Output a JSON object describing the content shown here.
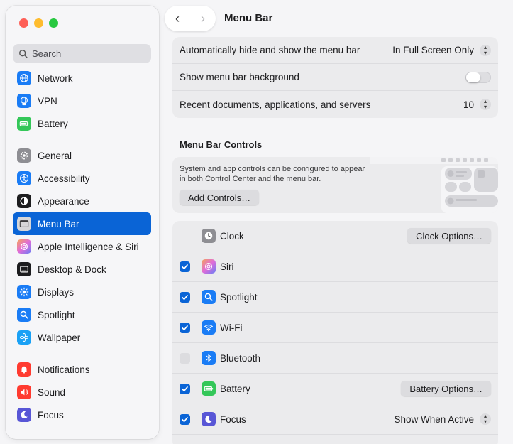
{
  "sidebar": {
    "search_placeholder": "Search",
    "items": [
      {
        "label": "Network",
        "icon": "globe-icon",
        "color": "#1a7cf5"
      },
      {
        "label": "VPN",
        "icon": "vpn-globe-icon",
        "color": "#1a7cf5"
      },
      {
        "label": "Battery",
        "icon": "battery-icon",
        "color": "#34c759"
      },
      {
        "label": "General",
        "icon": "gear-icon",
        "color": "#8e8e93"
      },
      {
        "label": "Accessibility",
        "icon": "accessibility-icon",
        "color": "#1a7cf5"
      },
      {
        "label": "Appearance",
        "icon": "appearance-icon",
        "color": "#1d1d1f"
      },
      {
        "label": "Menu Bar",
        "icon": "menu-bar-icon",
        "color": "#ffffff"
      },
      {
        "label": "Apple Intelligence & Siri",
        "icon": "siri-icon",
        "color": "#e06cd8"
      },
      {
        "label": "Desktop & Dock",
        "icon": "dock-icon",
        "color": "#1d1d1f"
      },
      {
        "label": "Displays",
        "icon": "sun-icon",
        "color": "#1a7cf5"
      },
      {
        "label": "Spotlight",
        "icon": "magnifier-icon",
        "color": "#1a7cf5"
      },
      {
        "label": "Wallpaper",
        "icon": "flower-icon",
        "color": "#1aa1f5"
      },
      {
        "label": "Notifications",
        "icon": "bell-icon",
        "color": "#ff3b30"
      },
      {
        "label": "Sound",
        "icon": "speaker-icon",
        "color": "#ff3b30"
      },
      {
        "label": "Focus",
        "icon": "moon-icon",
        "color": "#5856d6"
      }
    ]
  },
  "header": {
    "title": "Menu Bar",
    "back": "‹",
    "forward": "›"
  },
  "settings": {
    "auto_hide_label": "Automatically hide and show the menu bar",
    "auto_hide_value": "In Full Screen Only",
    "background_label": "Show menu bar background",
    "recent_label": "Recent documents, applications, and servers",
    "recent_value": "10"
  },
  "controls": {
    "title": "Menu Bar Controls",
    "description": "System and app controls can be configured to appear in both Control Center and the menu bar.",
    "add_button": "Add Controls…"
  },
  "items": {
    "clock": {
      "label": "Clock",
      "button": "Clock Options…"
    },
    "siri": {
      "label": "Siri"
    },
    "spotlight": {
      "label": "Spotlight"
    },
    "wifi": {
      "label": "Wi-Fi"
    },
    "bluetooth": {
      "label": "Bluetooth"
    },
    "battery": {
      "label": "Battery",
      "button": "Battery Options…"
    },
    "focus": {
      "label": "Focus",
      "value": "Show When Active"
    }
  },
  "colors": {
    "accent": "#0a64d6"
  }
}
